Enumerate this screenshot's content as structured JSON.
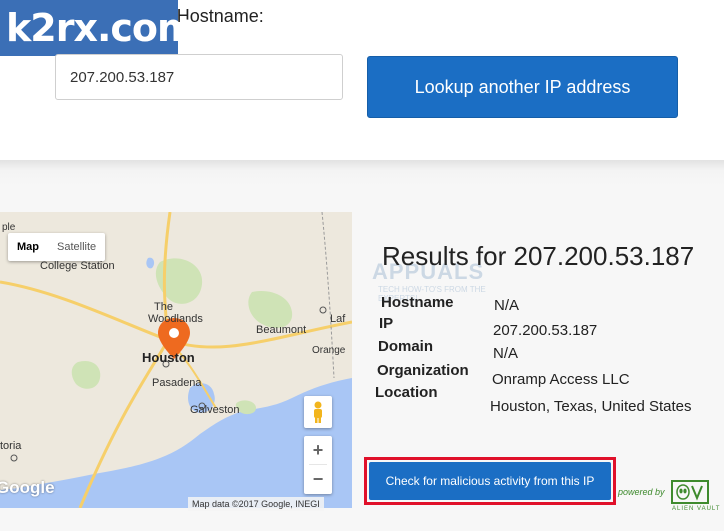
{
  "header": {
    "ip_label": "IP Address or Hostname:",
    "logo": "k2rx.com"
  },
  "lookup": {
    "input_value": "207.200.53.187",
    "button_label": "Lookup another IP address"
  },
  "map": {
    "tabs": [
      {
        "label": "Map",
        "active": true
      },
      {
        "label": "Satellite",
        "active": false
      }
    ],
    "cities": {
      "temple": "ple",
      "college_station": "College Station",
      "the_woodlands_1": "The",
      "the_woodlands_2": "Woodlands",
      "beaumont": "Beaumont",
      "orange": "Orange",
      "houston": "Houston",
      "pasadena": "Pasadena",
      "galveston": "Galveston",
      "victoria": "toria",
      "lafayette": "Laf"
    },
    "zoom_in": "+",
    "zoom_out": "−",
    "google": "Google",
    "attribution": "Map data ©2017 Google, INEGI"
  },
  "results": {
    "title": "Results for 207.200.53.187",
    "rows": [
      {
        "label": "Hostname",
        "value": "N/A"
      },
      {
        "label": "IP",
        "value": "207.200.53.187"
      },
      {
        "label": "Domain",
        "value": "N/A"
      },
      {
        "label": "Organization",
        "value": "Onramp Access LLC"
      },
      {
        "label": "Location",
        "value": "Houston, Texas, United States"
      }
    ]
  },
  "watermark": {
    "text": "APPUALS",
    "subtext": "TECH HOW-TO'S FROM THE EXPERTS!"
  },
  "check": {
    "button_label": "Check for malicious activity from this IP"
  },
  "powered": {
    "text": "powered by",
    "brand": "ALIEN VAULT"
  },
  "colors": {
    "primary_button": "#1b6ec4",
    "highlight_box": "#e0102a",
    "map_pin": "#ee6a1f",
    "water": "#a9c6f5",
    "land": "#ede8dd",
    "brand_green": "#3e8a2d"
  }
}
